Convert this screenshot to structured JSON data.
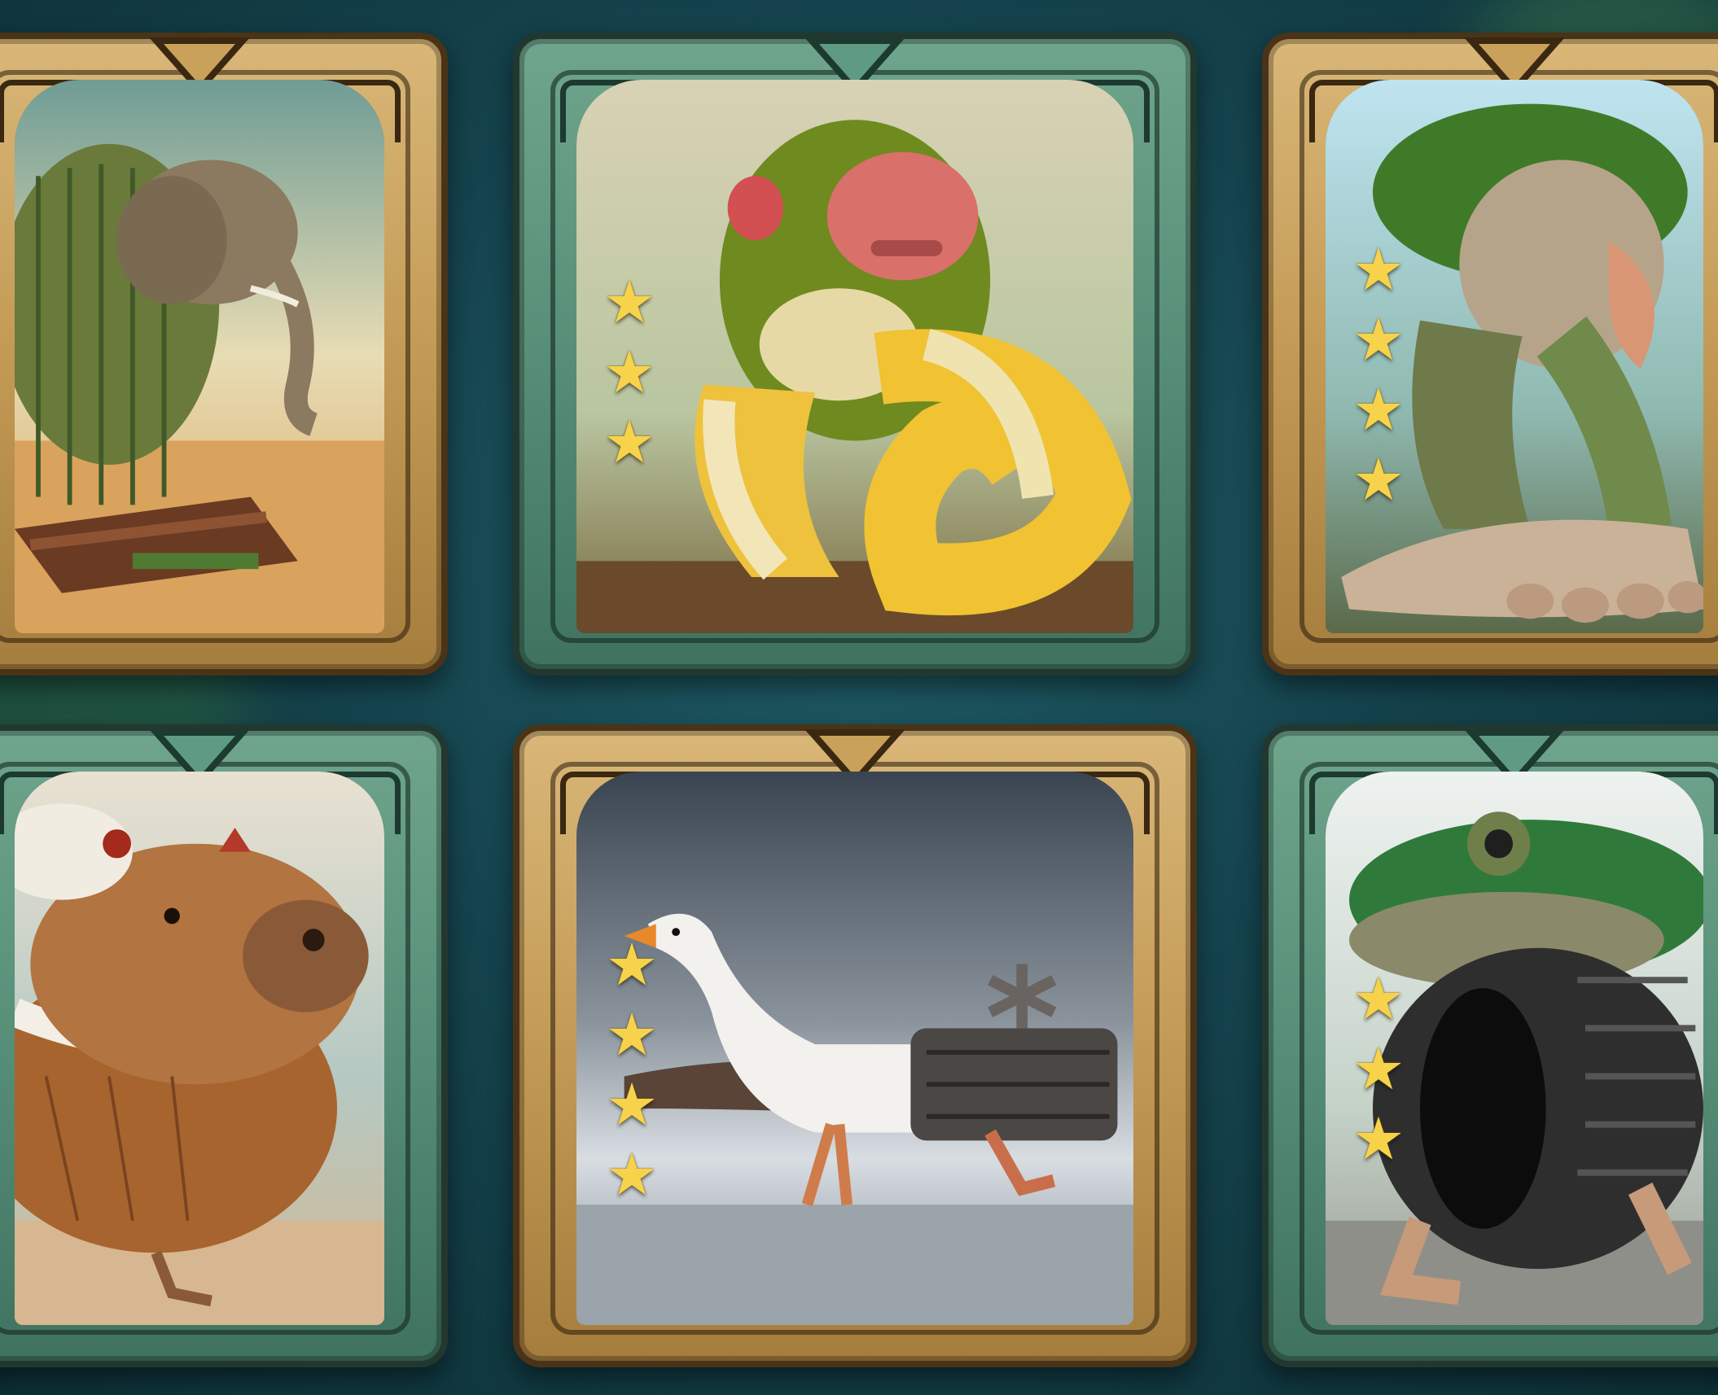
{
  "cards": [
    {
      "creature": "elephant-cactus-sandal",
      "frame": "gold",
      "stars": 0,
      "frame_color": "#c9a15a"
    },
    {
      "creature": "monkey-banana",
      "frame": "teal",
      "stars": 3,
      "frame_color": "#5f9b83"
    },
    {
      "creature": "proboscis-tree-foot",
      "frame": "gold",
      "stars": 4,
      "frame_color": "#c9a15a"
    },
    {
      "creature": "capybara-coconut",
      "frame": "teal",
      "stars": 0,
      "frame_color": "#5f9b83"
    },
    {
      "creature": "goose-tank",
      "frame": "gold",
      "stars": 4,
      "frame_color": "#c9a15a"
    },
    {
      "creature": "frog-tire",
      "frame": "teal",
      "stars": 3,
      "frame_color": "#5f9b83"
    }
  ],
  "icons": {
    "star": "star-icon"
  },
  "colors": {
    "background": "#15434d",
    "star": "#f6d34a"
  }
}
